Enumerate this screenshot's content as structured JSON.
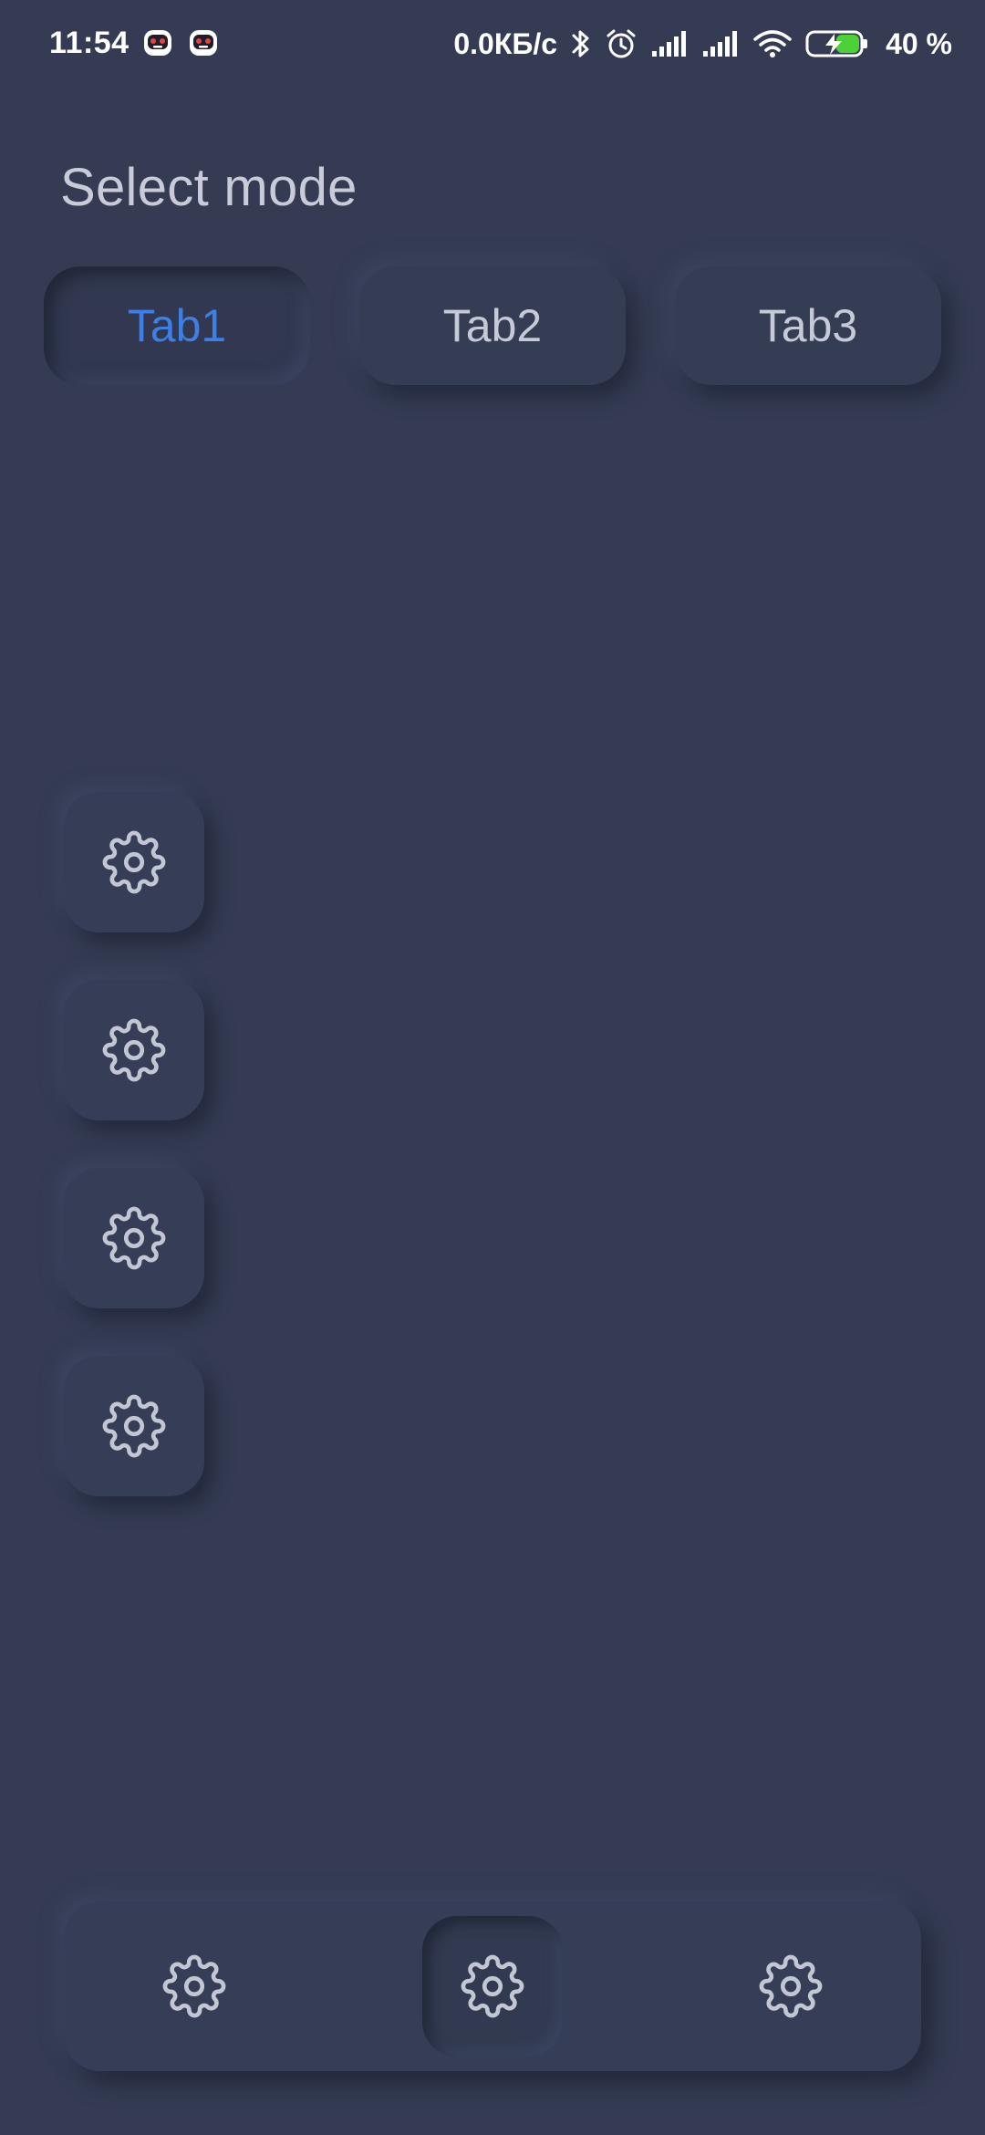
{
  "status_bar": {
    "time": "11:54",
    "net_speed": "0.0КБ/с",
    "battery_percent": "40 %",
    "notification_icons": [
      "app-mascot-icon",
      "app-mascot-icon"
    ],
    "system_icons": [
      "bluetooth-icon",
      "alarm-icon",
      "signal-icon",
      "signal-icon",
      "wifi-icon",
      "battery-charging-icon"
    ]
  },
  "page": {
    "title": "Select mode"
  },
  "tabs": [
    {
      "label": "Tab1",
      "active": true
    },
    {
      "label": "Tab2",
      "active": false
    },
    {
      "label": "Tab3",
      "active": false
    }
  ],
  "side_buttons": [
    {
      "icon": "gear-icon"
    },
    {
      "icon": "gear-icon"
    },
    {
      "icon": "gear-icon"
    },
    {
      "icon": "gear-icon"
    }
  ],
  "bottom_nav": {
    "items": [
      {
        "icon": "gear-icon",
        "active": false
      },
      {
        "icon": "gear-icon",
        "active": true
      },
      {
        "icon": "gear-icon",
        "active": false
      }
    ]
  },
  "colors": {
    "background": "#343b53",
    "accent": "#3d7fe6",
    "text": "#c9ccd8",
    "icon": "#c3c7d4",
    "battery_fill": "#4cd137"
  }
}
